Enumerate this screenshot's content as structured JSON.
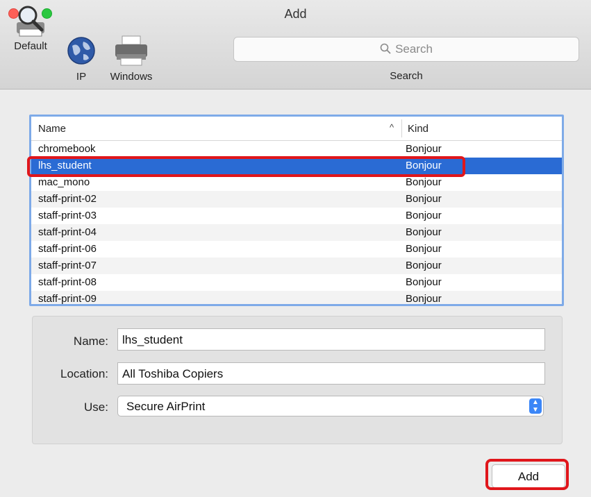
{
  "window": {
    "title": "Add"
  },
  "toolbar": {
    "default_label": "Default",
    "ip_label": "IP",
    "windows_label": "Windows",
    "search_placeholder": "Search",
    "search_caption": "Search"
  },
  "list": {
    "col_name": "Name",
    "col_kind": "Kind",
    "sort_indicator": "^",
    "rows": [
      {
        "name": "chromebook",
        "kind": "Bonjour"
      },
      {
        "name": "lhs_student",
        "kind": "Bonjour",
        "selected": true
      },
      {
        "name": "mac_mono",
        "kind": "Bonjour"
      },
      {
        "name": "staff-print-02",
        "kind": "Bonjour"
      },
      {
        "name": "staff-print-03",
        "kind": "Bonjour"
      },
      {
        "name": "staff-print-04",
        "kind": "Bonjour"
      },
      {
        "name": "staff-print-06",
        "kind": "Bonjour"
      },
      {
        "name": "staff-print-07",
        "kind": "Bonjour"
      },
      {
        "name": "staff-print-08",
        "kind": "Bonjour"
      },
      {
        "name": "staff-print-09",
        "kind": "Bonjour"
      }
    ]
  },
  "form": {
    "name_label": "Name:",
    "name_value": "lhs_student",
    "location_label": "Location:",
    "location_value": "All Toshiba Copiers",
    "use_label": "Use:",
    "use_value": "Secure AirPrint"
  },
  "buttons": {
    "add_label": "Add"
  },
  "colors": {
    "selection": "#2a6bd4",
    "highlight": "#e0161b",
    "focus_ring": "#7eaae8"
  }
}
